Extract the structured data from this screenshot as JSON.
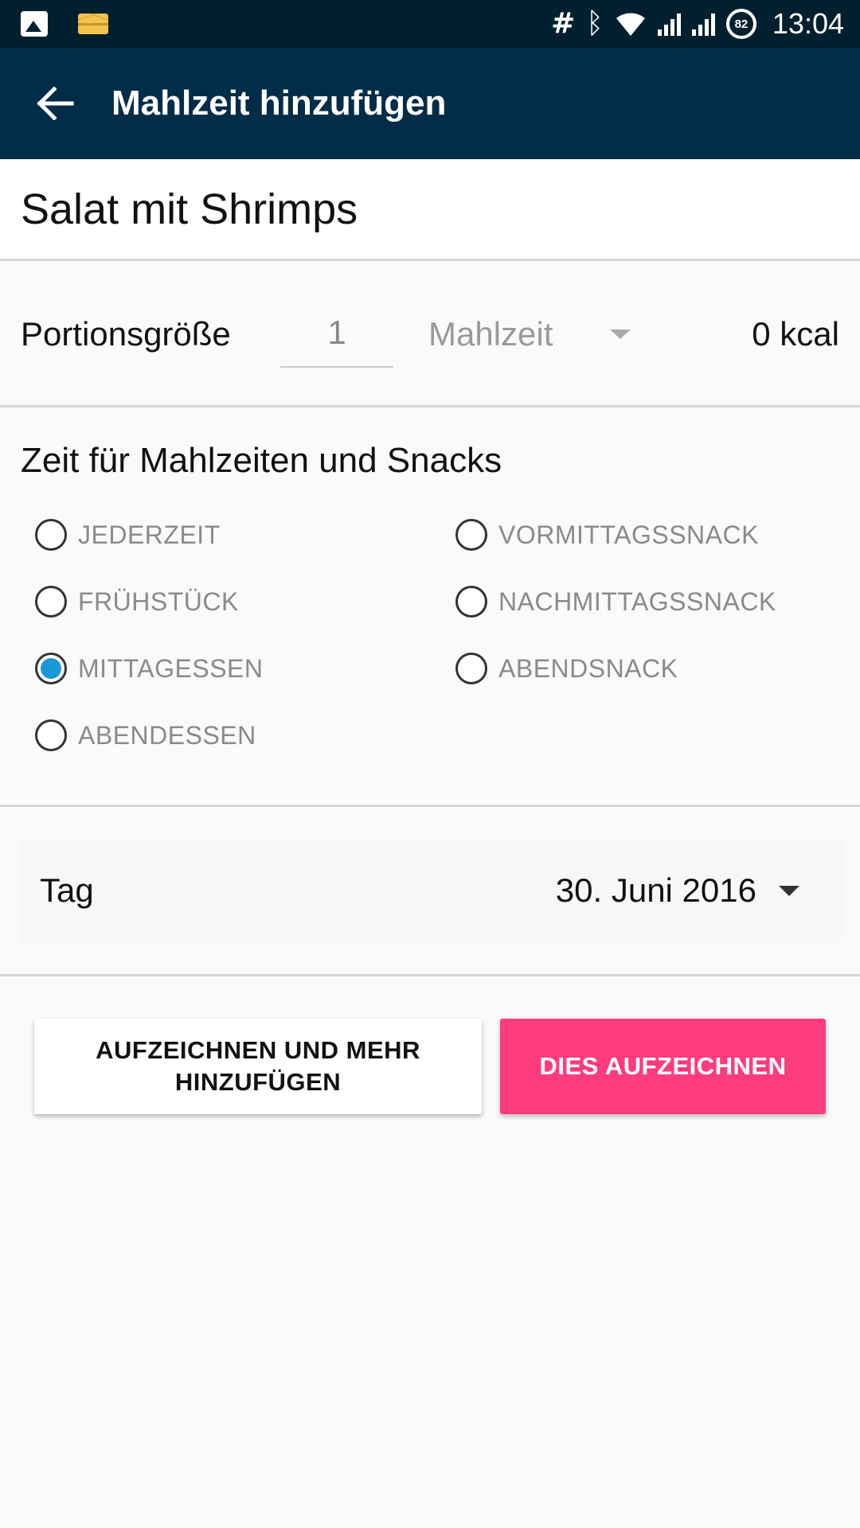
{
  "status_bar": {
    "left_icons": [
      "image-icon",
      "mail-icon"
    ],
    "right_icons": [
      "hash-icon",
      "bluetooth-icon",
      "wifi-icon",
      "signal-icon",
      "signal-icon",
      "battery-icon"
    ],
    "battery_level": "82",
    "time": "13:04"
  },
  "app_bar": {
    "back_icon": "arrow-left-icon",
    "title": "Mahlzeit hinzufügen",
    "background": "#012d49"
  },
  "food": {
    "name": "Salat mit Shrimps"
  },
  "portion": {
    "label": "Portionsgröße",
    "quantity": "1",
    "unit": "Mahlzeit",
    "calories": "0 kcal"
  },
  "meal_time": {
    "heading": "Zeit für Mahlzeiten und Snacks",
    "options_left": [
      {
        "label": "JEDERZEIT",
        "checked": false
      },
      {
        "label": "FRÜHSTÜCK",
        "checked": false
      },
      {
        "label": "MITTAGESSEN",
        "checked": true
      },
      {
        "label": "ABENDESSEN",
        "checked": false
      }
    ],
    "options_right": [
      {
        "label": "VORMITTAGSSNACK",
        "checked": false
      },
      {
        "label": "NACHMITTAGSSNACK",
        "checked": false
      },
      {
        "label": "ABENDSNACK",
        "checked": false
      }
    ],
    "selected_color": "#1a98d5"
  },
  "day": {
    "label": "Tag",
    "value": "30. Juni 2016"
  },
  "actions": {
    "log_and_add_more": "AUFZEICHNEN UND MEHR HINZUFÜGEN",
    "log_this": "DIES AUFZEICHNEN",
    "primary_color": "#fc3c7e"
  }
}
